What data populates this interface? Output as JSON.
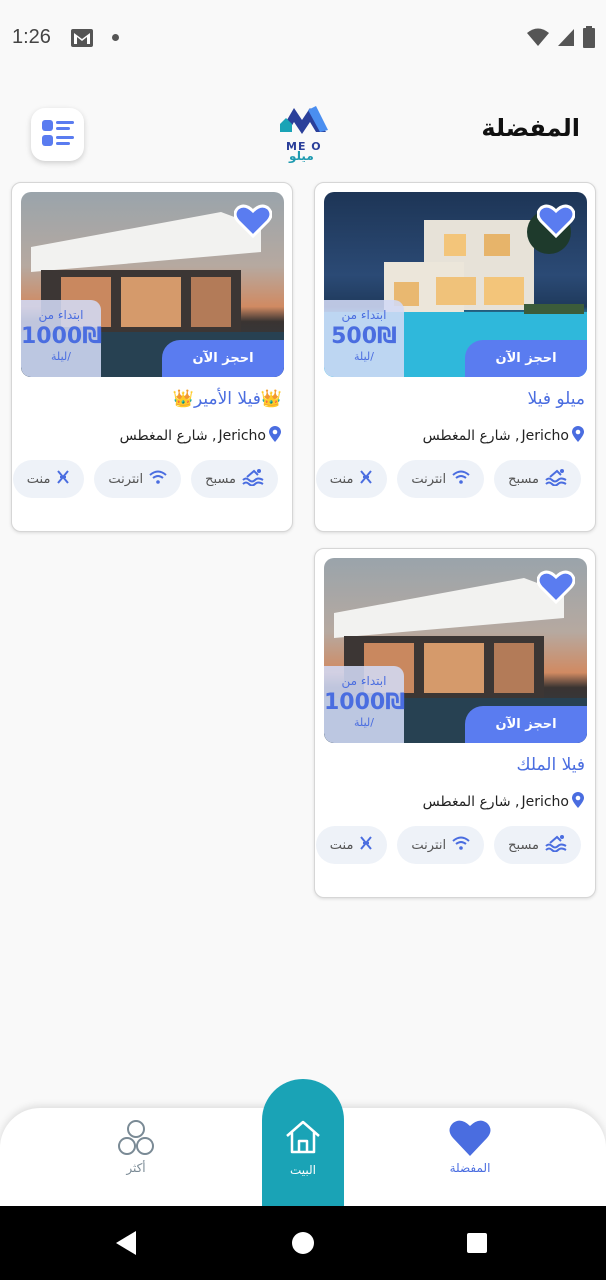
{
  "status_bar": {
    "time": "1:26"
  },
  "header": {
    "title": "المفضلة",
    "logo_en": "ME O",
    "logo_ar": "ميلو"
  },
  "cards": [
    {
      "title": "ميلو فيلا",
      "location_city": "Jericho",
      "location_street": ", شارع المغطس",
      "price_from": "ابتداء من",
      "price": "500₪",
      "price_unit": "/ليلة",
      "book_label": "احجز الآن",
      "amenities": [
        "مسبح",
        "انترنت",
        "منت"
      ],
      "image": "pool-villa-night"
    },
    {
      "title": "👑فيلا الأمير👑",
      "location_city": "Jericho",
      "location_street": ", شارع المغطس",
      "price_from": "ابتداء من",
      "price": "1000₪",
      "price_unit": "/ليلة",
      "book_label": "احجز الآن",
      "amenities": [
        "مسبح",
        "انترنت",
        "منت"
      ],
      "image": "modern-villa-sunset"
    },
    {
      "title": "فيلا الملك",
      "location_city": "Jericho",
      "location_street": ", شارع المغطس",
      "price_from": "ابتداء من",
      "price": "1000₪",
      "price_unit": "/ليلة",
      "book_label": "احجز الآن",
      "amenities": [
        "مسبح",
        "انترنت",
        "منت"
      ],
      "image": "modern-villa-sunset"
    }
  ],
  "bottom_nav": {
    "more_label": "أكثر",
    "home_label": "البيت",
    "favorites_label": "المفضلة"
  },
  "colors": {
    "accent": "#5a7cf0",
    "home": "#1aa3b6",
    "text_blue": "#4a6de0"
  }
}
